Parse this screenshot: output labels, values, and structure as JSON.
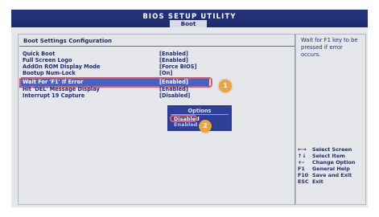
{
  "header": {
    "title": "BIOS SETUP UTILITY",
    "tab_label": "Boot"
  },
  "main": {
    "section_title": "Boot Settings Configuration",
    "rows": [
      {
        "label": "Quick Boot",
        "value": "[Enabled]"
      },
      {
        "label": "Full Screen Logo",
        "value": "[Enabled]"
      },
      {
        "label": "AddOn ROM Display Mode",
        "value": "[Force BIOS]"
      },
      {
        "label": "Bootup Num-Lock",
        "value": "[On]"
      },
      {
        "label": "Wait For 'F1' If Error",
        "value": "[Enabled]"
      },
      {
        "label": "Hit 'DEL' Message Display",
        "value": "[Enabled]"
      },
      {
        "label": "Interrupt 19 Capture",
        "value": "[Disabled]"
      }
    ]
  },
  "popup": {
    "title": "Options",
    "options": [
      "Disabled",
      "Enabled"
    ]
  },
  "badges": [
    "1",
    "2"
  ],
  "sidebar": {
    "help_text": "Wait for F1 key to be pressed if error occurs.",
    "legend": [
      {
        "key": "←→",
        "desc": "Select Screen"
      },
      {
        "key": "↑↓",
        "desc": "Select Item"
      },
      {
        "key": "+-",
        "desc": "Change Option"
      },
      {
        "key": "F1",
        "desc": "General Help"
      },
      {
        "key": "F10",
        "desc": "Save and Exit"
      },
      {
        "key": "ESC",
        "desc": "Exit"
      }
    ]
  },
  "colors": {
    "background": "#e5e6ea",
    "accent": "#1d2a6f",
    "selection": "#4c60c1",
    "annotation": "#f0a33d",
    "highlight": "#d96062"
  }
}
